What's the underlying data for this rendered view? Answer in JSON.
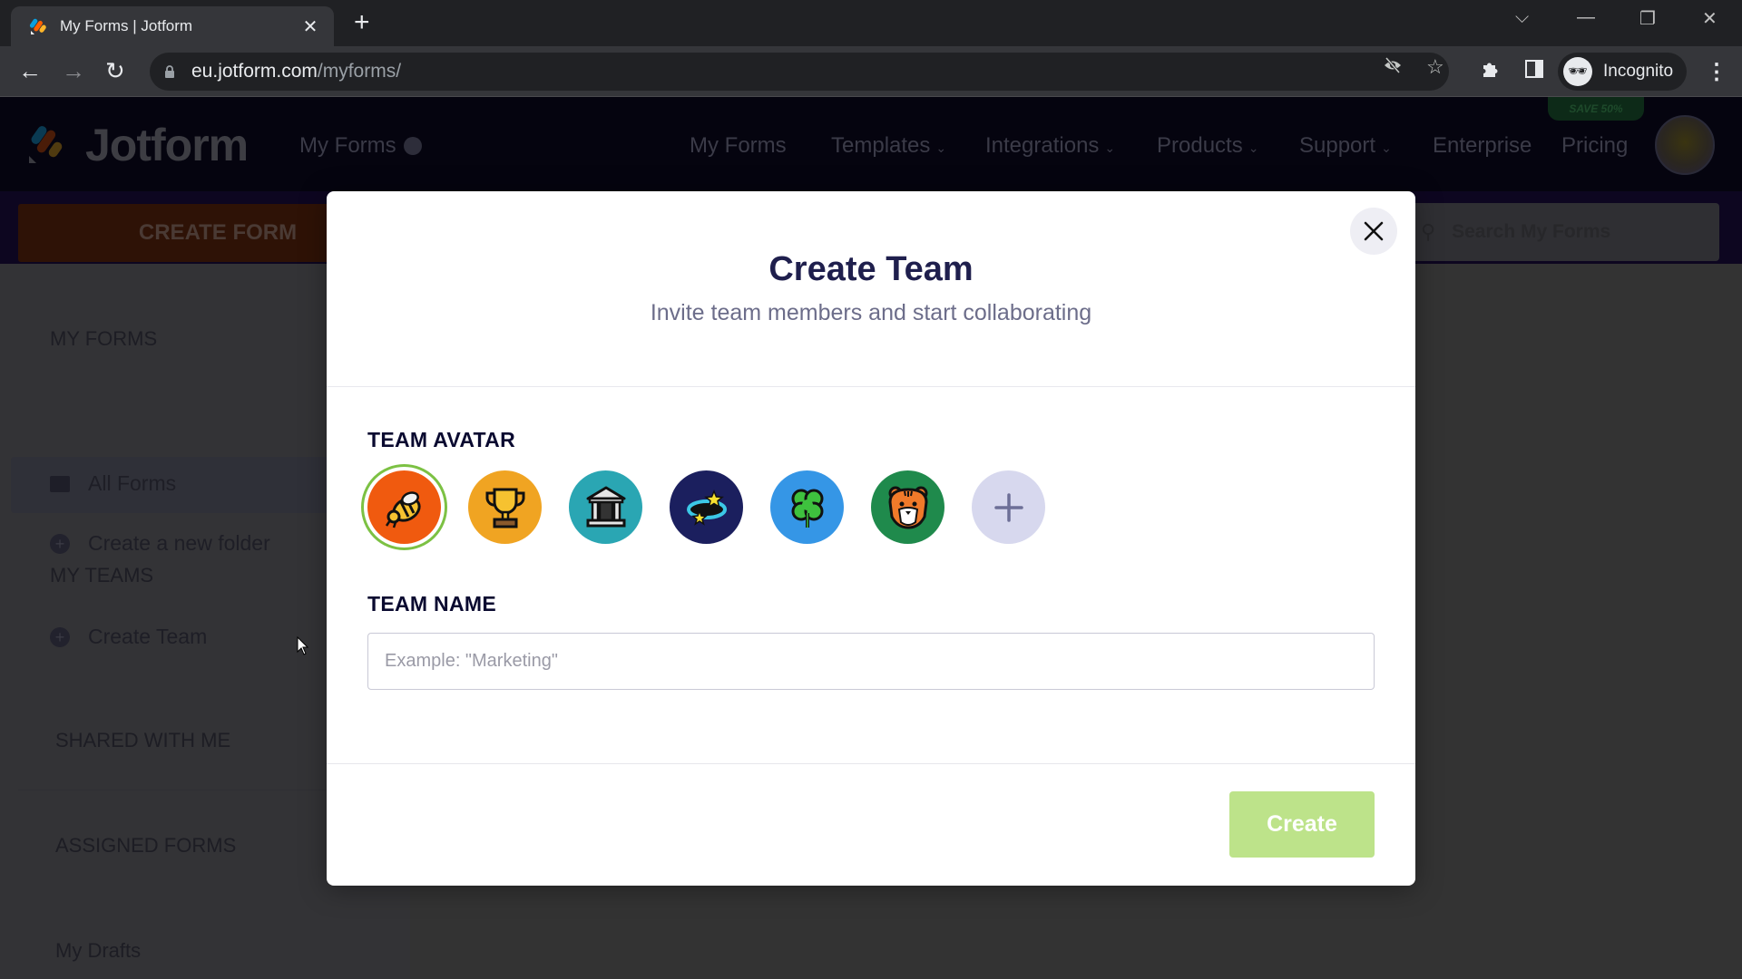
{
  "browser": {
    "tab_title": "My Forms | Jotform",
    "url_host": "eu.jotform.com",
    "url_path": "/myforms/",
    "profile_label": "Incognito"
  },
  "header": {
    "logo_text": "Jotform",
    "my_forms_label": "My Forms",
    "nav": [
      {
        "label": "My Forms",
        "dropdown": false
      },
      {
        "label": "Templates",
        "dropdown": true
      },
      {
        "label": "Integrations",
        "dropdown": true
      },
      {
        "label": "Products",
        "dropdown": true
      },
      {
        "label": "Support",
        "dropdown": true
      },
      {
        "label": "Enterprise",
        "dropdown": false
      },
      {
        "label": "Pricing",
        "dropdown": false
      }
    ],
    "promo_badge": "SAVE 50%"
  },
  "toolbar": {
    "create_form_label": "CREATE FORM",
    "search_placeholder": "Search My Forms"
  },
  "sidebar": {
    "my_forms_heading": "MY FORMS",
    "all_forms_label": "All Forms",
    "create_folder_label": "Create a new folder",
    "my_teams_heading": "MY TEAMS",
    "create_team_label": "Create Team",
    "shared_heading": "SHARED WITH ME",
    "assigned_heading": "ASSIGNED FORMS",
    "drafts_label": "My Drafts"
  },
  "modal": {
    "title": "Create Team",
    "subtitle": "Invite team members and start collaborating",
    "avatar_label": "TEAM AVATAR",
    "avatars": [
      {
        "name": "bee",
        "bg": "#f05a0f",
        "selected": true
      },
      {
        "name": "trophy",
        "bg": "#f0a422",
        "selected": false
      },
      {
        "name": "bank-building",
        "bg": "#2aa6b3",
        "selected": false
      },
      {
        "name": "stars-orbit",
        "bg": "#1b1f5e",
        "selected": false
      },
      {
        "name": "four-leaf-clover",
        "bg": "#3596e6",
        "selected": false
      },
      {
        "name": "tiger",
        "bg": "#1f8a4c",
        "selected": false
      },
      {
        "name": "add-custom",
        "bg": "#d7d8ee",
        "selected": false
      }
    ],
    "name_label": "TEAM NAME",
    "name_value": "",
    "name_placeholder": "Example: \"Marketing\"",
    "create_label": "Create"
  },
  "colors": {
    "accent_green": "#7cc143",
    "create_button_disabled": "#bde38a",
    "title_navy": "#1f1f4d"
  }
}
